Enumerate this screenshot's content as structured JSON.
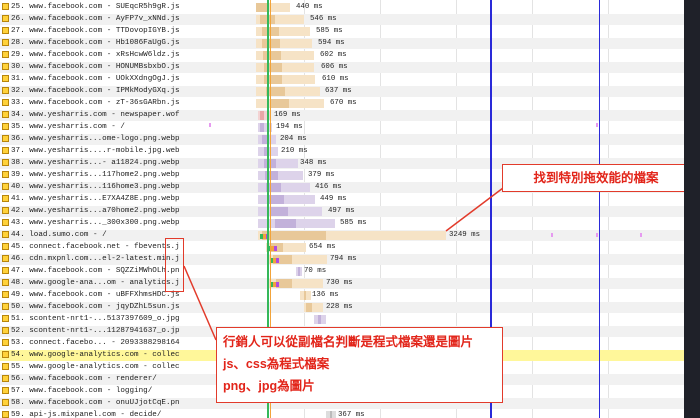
{
  "waterfall": {
    "rows": [
      {
        "num": "25.",
        "label": "www.facebook.com - SUEqcR5h9gR.js",
        "lock": true,
        "type": "js",
        "ms": "440 ms"
      },
      {
        "num": "26.",
        "label": "www.facebook.com - AyFP7v_xNNd.js",
        "lock": true,
        "type": "js",
        "ms": "546 ms"
      },
      {
        "num": "27.",
        "label": "www.facebook.com - TTDovopIGYB.js",
        "lock": true,
        "type": "js",
        "ms": "585 ms"
      },
      {
        "num": "28.",
        "label": "www.facebook.com - Hb1086FaUgG.js",
        "lock": true,
        "type": "js",
        "ms": "594 ms"
      },
      {
        "num": "29.",
        "label": "www.facebook.com - xRsHcwW6ldz.js",
        "lock": true,
        "type": "js",
        "ms": "602 ms"
      },
      {
        "num": "30.",
        "label": "www.facebook.com - HONUMBsbxbO.js",
        "lock": true,
        "type": "js",
        "ms": "606 ms"
      },
      {
        "num": "31.",
        "label": "www.facebook.com - UOkXXdngOgJ.js",
        "lock": true,
        "type": "js",
        "ms": "610 ms"
      },
      {
        "num": "32.",
        "label": "www.facebook.com - IPMkModyGXq.js",
        "lock": true,
        "type": "js",
        "ms": "637 ms"
      },
      {
        "num": "33.",
        "label": "www.facebook.com - zT-36sGARbn.js",
        "lock": true,
        "type": "js",
        "ms": "670 ms"
      },
      {
        "num": "34.",
        "label": "www.yesharris.com - newspaper.woff",
        "lock": true,
        "type": "font",
        "ms": "169 ms"
      },
      {
        "num": "35.",
        "label": "www.yesharris.com - /",
        "lock": true,
        "type": "html",
        "ms": "194 ms"
      },
      {
        "num": "36.",
        "label": "www.yesharris...ome-logo.png.webp",
        "lock": true,
        "type": "img",
        "ms": "204 ms"
      },
      {
        "num": "37.",
        "label": "www.yesharris....r-mobile.jpg.webp",
        "lock": true,
        "type": "img",
        "ms": "210 ms"
      },
      {
        "num": "38.",
        "label": "www.yesharris...- a11824.png.webp",
        "lock": true,
        "type": "img",
        "ms": "348 ms"
      },
      {
        "num": "39.",
        "label": "www.yesharris...117home2.png.webp",
        "lock": true,
        "type": "img",
        "ms": "379 ms"
      },
      {
        "num": "40.",
        "label": "www.yesharris...116home3.png.webp",
        "lock": true,
        "type": "img",
        "ms": "416 ms"
      },
      {
        "num": "41.",
        "label": "www.yesharris...E7XA4Z8E.png.webp",
        "lock": true,
        "type": "img",
        "ms": "449 ms"
      },
      {
        "num": "42.",
        "label": "www.yesharris...a70home2.png.webp",
        "lock": true,
        "type": "img",
        "ms": "497 ms"
      },
      {
        "num": "43.",
        "label": "www.yesharris..._300x300.png.webp",
        "lock": true,
        "type": "img",
        "ms": "585 ms"
      },
      {
        "num": "44.",
        "label": "load.sumo.com - /",
        "lock": true,
        "type": "js",
        "ms": "3249 ms"
      },
      {
        "num": "45.",
        "label": "connect.facebook.net - fbevents.js",
        "lock": true,
        "type": "js",
        "ms": "654 ms"
      },
      {
        "num": "46.",
        "label": "cdn.mxpnl.com...el-2-latest.min.js",
        "lock": true,
        "type": "js",
        "ms": "794 ms"
      },
      {
        "num": "47.",
        "label": "www.facebook.com - SQZZiMWhOLh.png",
        "lock": true,
        "type": "img",
        "ms": "70 ms"
      },
      {
        "num": "48.",
        "label": "www.google-ana...om - analytics.js",
        "lock": true,
        "type": "js",
        "ms": "730 ms"
      },
      {
        "num": "49.",
        "label": "www.facebook.com - uBFFXhmsHDC.js",
        "lock": true,
        "type": "js",
        "ms": "136 ms"
      },
      {
        "num": "50.",
        "label": "www.facebook.com - jqyDZhL5sun.js",
        "lock": true,
        "type": "js",
        "ms": "228 ms"
      },
      {
        "num": "51.",
        "label": "scontent-nrt1-...5137397609_o.jpg",
        "lock": true,
        "type": "img",
        "ms": ""
      },
      {
        "num": "52.",
        "label": "scontent-nrt1-...11287941637_o.jpg",
        "lock": true,
        "type": "img",
        "ms": ""
      },
      {
        "num": "53.",
        "label": "connect.facebo... - 209338829816427",
        "lock": true,
        "type": "js",
        "ms": ""
      },
      {
        "num": "54.",
        "label": "www.google-analytics.com - collect",
        "lock": true,
        "type": "other",
        "ms": "",
        "highlight": true
      },
      {
        "num": "55.",
        "label": "www.google-analytics.com - collect",
        "lock": true,
        "type": "other",
        "ms": ""
      },
      {
        "num": "56.",
        "label": "www.facebook.com - renderer/",
        "lock": true,
        "type": "other",
        "ms": ""
      },
      {
        "num": "57.",
        "label": "www.facebook.com - logging/",
        "lock": true,
        "type": "other",
        "ms": ""
      },
      {
        "num": "58.",
        "label": "www.facebook.com - onuUJjotCqE.png",
        "lock": true,
        "type": "img",
        "ms": ""
      },
      {
        "num": "59.",
        "label": "api-js.mixpanel.com - decide/",
        "lock": true,
        "type": "other",
        "ms": "367 ms"
      }
    ]
  },
  "annotations": {
    "top": "找到特別拖效能的檔案",
    "bottom_line1": "行銷人可以從副檔名判斷是程式檔案還是圖片",
    "bottom_line2": "js、css為程式檔案",
    "bottom_line3": "png、jpg為圖片"
  },
  "colors": {
    "js_wait": "#f6e3c6",
    "js_dl": "#e8c899",
    "img_wait": "#ddd3ea",
    "img_dl": "#c2b1da",
    "font_wait": "#f3d3d3",
    "font_dl": "#e9a6a6",
    "highlight": "#fff79a",
    "annotation": "#e2251a",
    "blue_line": "#2a2ad8",
    "green_line": "#35b85a",
    "orange_line": "#f2a33a"
  }
}
